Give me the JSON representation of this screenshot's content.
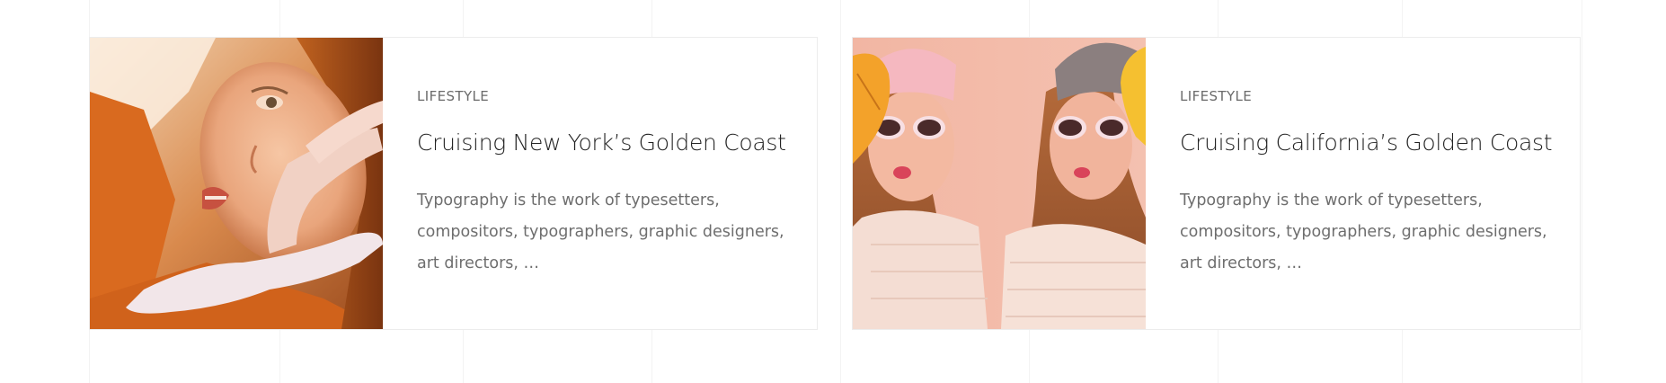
{
  "cards": [
    {
      "image_alt": "Woman with orange sweater lying in sunlight",
      "category": "LIFESTYLE",
      "title": "Cruising New York’s Golden Coast",
      "excerpt": "Typography is the work of typesetters, compositors, typographers, graphic designers, art directors, …"
    },
    {
      "image_alt": "Two women in pink hats and sunglasses with autumn leaves",
      "category": "LIFESTYLE",
      "title": "Cruising California’s Golden Coast",
      "excerpt": "Typography is the work of typesetters, compositors, typographers, graphic designers, art directors, …"
    }
  ],
  "colors": {
    "card_border": "#ececec",
    "category_text": "#6b6b6b",
    "title_text": "#222222",
    "excerpt_text": "#6e6e6e"
  }
}
